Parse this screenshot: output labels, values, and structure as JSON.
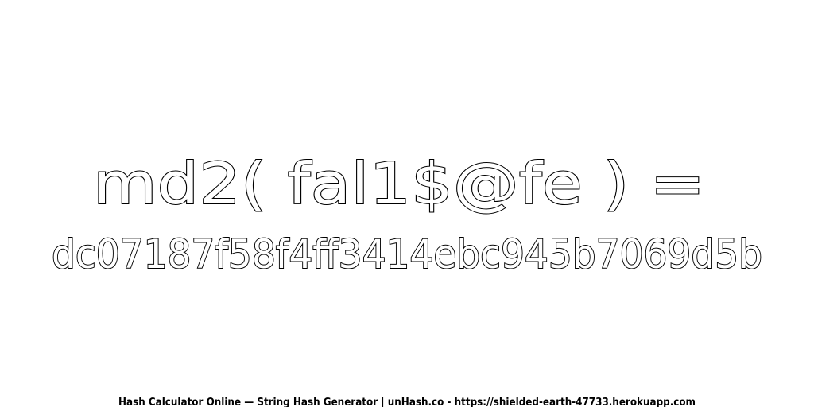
{
  "headline": "md2( fal1$@fe ) =",
  "hash_value": "dc07187f58f4ff3414ebc945b7069d5b",
  "footer": "Hash Calculator Online — String Hash Generator | unHash.co - https://shielded-earth-47733.herokuapp.com"
}
